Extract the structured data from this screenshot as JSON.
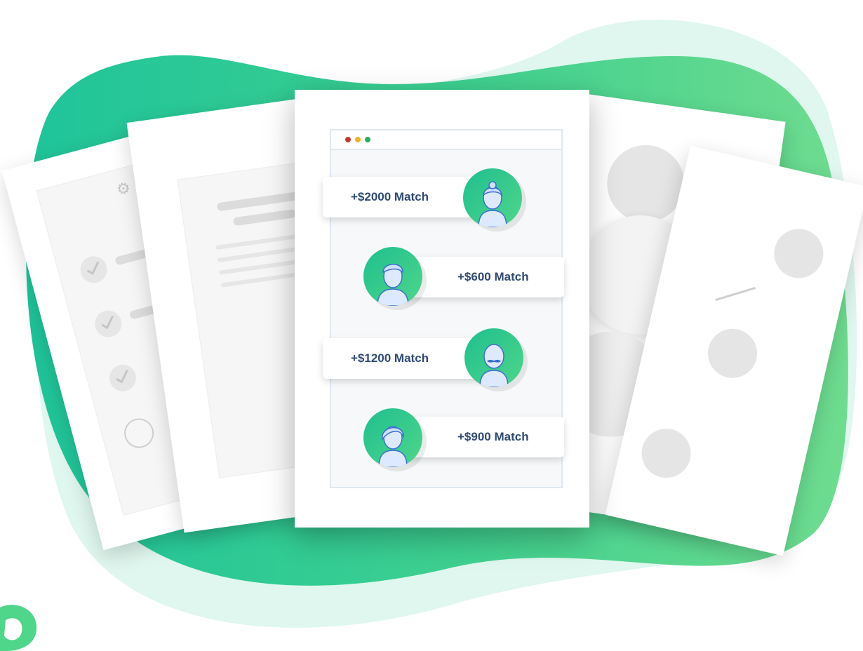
{
  "colors": {
    "blob_dark": "#22c79a",
    "blob_mid": "#5bd88f",
    "blob_light": "#dff7ee",
    "text": "#2f4a73",
    "avatar_start": "#1fbf8f",
    "avatar_end": "#4fd68a"
  },
  "browser": {
    "dots": [
      "red",
      "yellow",
      "green"
    ]
  },
  "matches": [
    {
      "label": "+$2000 Match",
      "avatar_icon": "woman-avatar-icon"
    },
    {
      "label": "+$600 Match",
      "avatar_icon": "man-avatar-icon"
    },
    {
      "label": "+$1200 Match",
      "avatar_icon": "mustache-man-avatar-icon"
    },
    {
      "label": "+$900 Match",
      "avatar_icon": "woman-avatar-icon"
    }
  ]
}
